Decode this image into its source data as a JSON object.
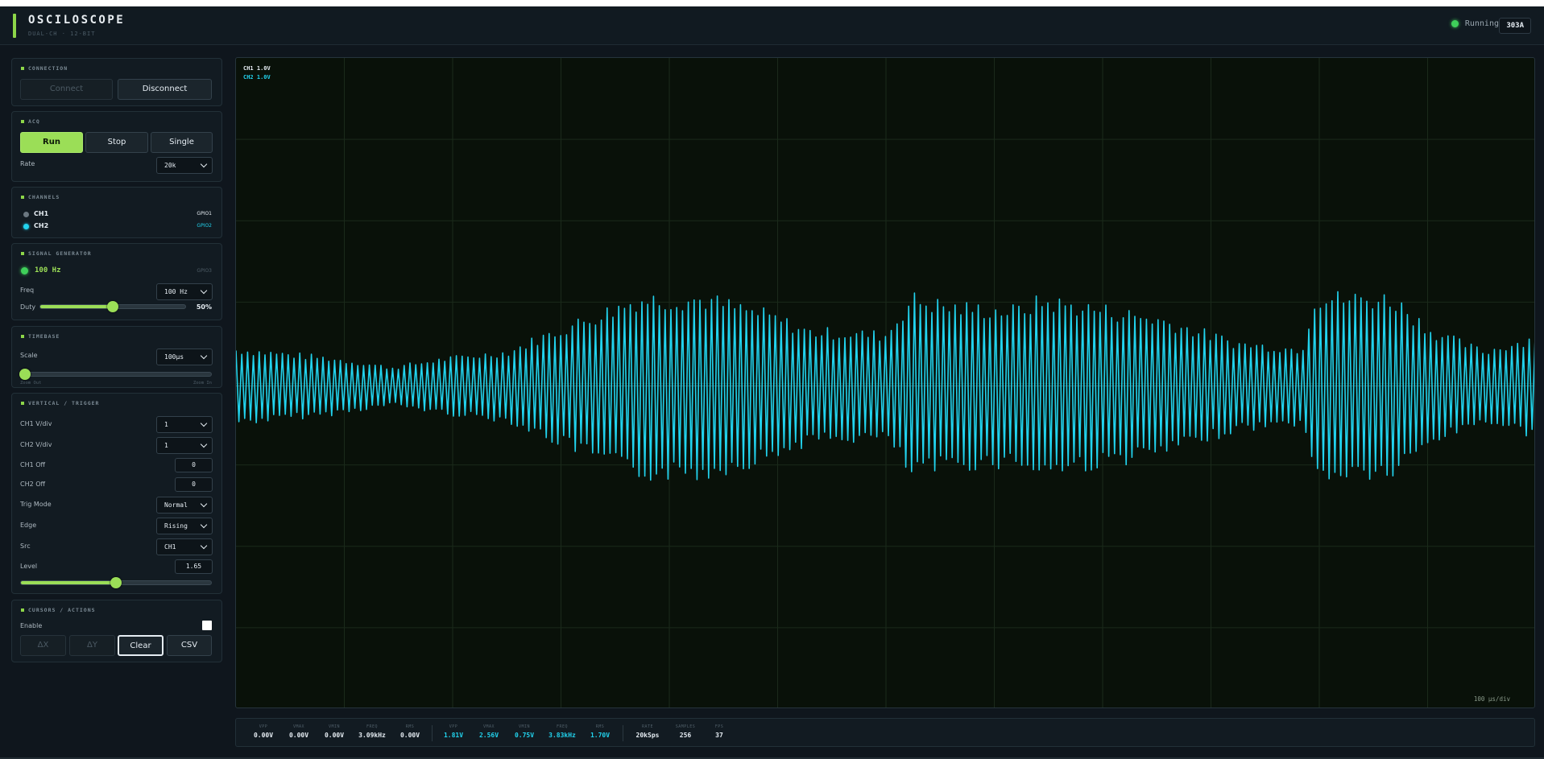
{
  "header": {
    "title": "OSCILOSCOPE",
    "subtitle": "DUAL-CH · 12-BIT",
    "status": "Running",
    "badge": "303A",
    "status_color": "#3fcf5a"
  },
  "connection": {
    "title": "CONNECTION",
    "connect_label": "Connect",
    "disconnect_label": "Disconnect"
  },
  "acq": {
    "title": "ACQ",
    "run_label": "Run",
    "stop_label": "Stop",
    "single_label": "Single",
    "rate_label": "Rate",
    "rate_value": "20k"
  },
  "channels": {
    "title": "CHANNELS",
    "items": [
      {
        "name": "CH1",
        "pin": "GPIO1",
        "color": "#6b7780"
      },
      {
        "name": "CH2",
        "pin": "GPIO2",
        "color": "#22d3ee"
      }
    ]
  },
  "siggen": {
    "title": "SIGNAL GENERATOR",
    "readout": "100 Hz",
    "pin": "GPIO3",
    "freq_label": "Freq",
    "freq_value": "100 Hz",
    "duty_label": "Duty",
    "duty_value": "50%",
    "duty_fraction": 0.5
  },
  "timebase": {
    "title": "TIMEBASE",
    "scale_label": "Scale",
    "scale_value": "100µs",
    "zoom_out": "Zoom Out",
    "zoom_in": "Zoom In",
    "zoom_fraction": 0.02
  },
  "vertical": {
    "title": "VERTICAL / TRIGGER",
    "ch1_vdiv_label": "CH1 V/div",
    "ch1_vdiv": "1",
    "ch2_vdiv_label": "CH2 V/div",
    "ch2_vdiv": "1",
    "ch1_off_label": "CH1 Off",
    "ch1_off": "0",
    "ch2_off_label": "CH2 Off",
    "ch2_off": "0",
    "trig_mode_label": "Trig Mode",
    "trig_mode": "Normal",
    "edge_label": "Edge",
    "edge": "Rising",
    "src_label": "Src",
    "src": "CH1",
    "level_label": "Level",
    "level": "1.65",
    "level_fraction": 0.5
  },
  "cursors": {
    "title": "CURSORS / ACTIONS",
    "enable_label": "Enable",
    "dx_label": "ΔX",
    "dy_label": "ΔY",
    "clear_label": "Clear",
    "csv_label": "CSV"
  },
  "scope": {
    "ch1_tag": "CH1 1.0V",
    "ch2_tag": "CH2 1.0V",
    "timediv": "100 µs/div",
    "trace_color": "#22d3ee",
    "ch1_color": "#e6edf3"
  },
  "measurements": {
    "ch1": [
      {
        "key": "VPP",
        "value": "0.00V"
      },
      {
        "key": "VMAX",
        "value": "0.00V"
      },
      {
        "key": "VMIN",
        "value": "0.00V"
      },
      {
        "key": "FREQ",
        "value": "3.09kHz"
      },
      {
        "key": "RMS",
        "value": "0.00V"
      }
    ],
    "ch2": [
      {
        "key": "VPP",
        "value": "1.81V"
      },
      {
        "key": "VMAX",
        "value": "2.56V"
      },
      {
        "key": "VMIN",
        "value": "0.75V"
      },
      {
        "key": "FREQ",
        "value": "3.83kHz"
      },
      {
        "key": "RMS",
        "value": "1.70V"
      }
    ],
    "stats": [
      {
        "key": "RATE",
        "value": "20kSps"
      },
      {
        "key": "SAMPLES",
        "value": "256"
      },
      {
        "key": "FPS",
        "value": "37"
      }
    ]
  }
}
